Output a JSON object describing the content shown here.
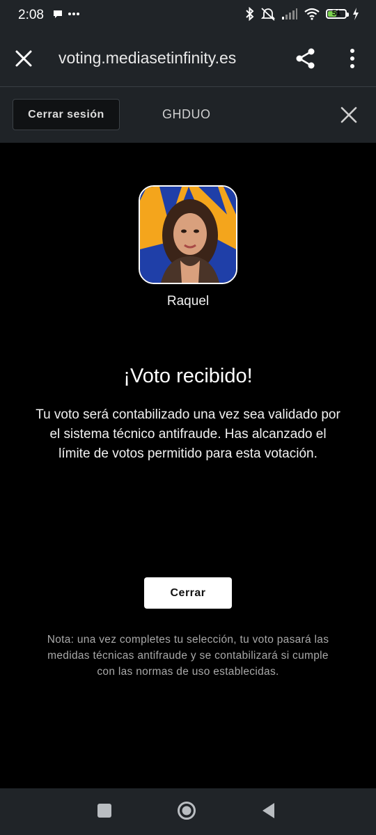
{
  "status_bar": {
    "time": "2:08",
    "battery_level": "51",
    "battery_fraction": 0.51,
    "icons": [
      "chat-bubble-icon",
      "more-dots-icon",
      "bluetooth-icon",
      "silent-icon",
      "signal-icon",
      "wifi-icon",
      "battery-icon",
      "charging-icon"
    ]
  },
  "browser": {
    "url": "voting.mediasetinfinity.es",
    "icons": [
      "close-icon",
      "share-icon",
      "more-vert-icon"
    ]
  },
  "session": {
    "logout_label": "Cerrar sesión",
    "user_code": "GHDUO"
  },
  "content": {
    "candidate_name": "Raquel",
    "title": "¡Voto recibido!",
    "message": "Tu voto será contabilizado una vez sea validado por el sistema técnico antifraude. Has alcanzado el límite de votos permitido para esta votación.",
    "close_label": "Cerrar",
    "note": "Nota: una vez completes tu selección, tu voto pasará las medidas técnicas antifraude y se contabilizará si cumple con las normas de uso establecidas."
  },
  "colors": {
    "background": "#000000",
    "chrome": "#202428",
    "battery_green": "#7bd04f",
    "avatar_blue": "#1f3fa8",
    "avatar_orange": "#f4a51c"
  }
}
